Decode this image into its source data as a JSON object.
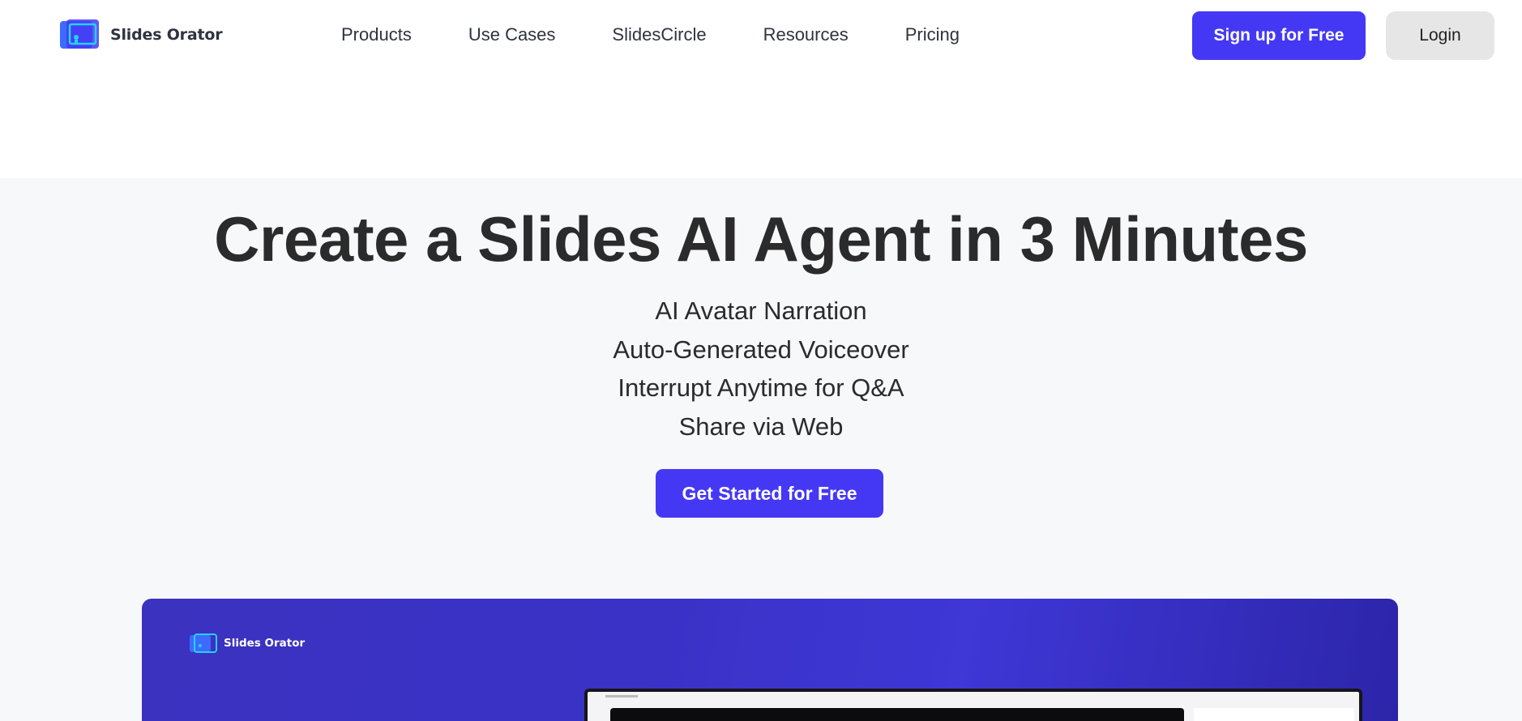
{
  "brand": {
    "name": "Slides Orator",
    "colors": {
      "primary": "#4538f5",
      "logo_blue": "#3d6bff",
      "logo_cyan": "#22d3ee",
      "hero_bg": "#f7f8fa",
      "preview_bg": "#3b32c6"
    }
  },
  "nav": {
    "items": [
      {
        "label": "Products"
      },
      {
        "label": "Use Cases"
      },
      {
        "label": "SlidesCircle"
      },
      {
        "label": "Resources"
      },
      {
        "label": "Pricing"
      }
    ]
  },
  "header": {
    "signup_label": "Sign up for Free",
    "login_label": "Login"
  },
  "hero": {
    "title": "Create a Slides AI Agent in 3 Minutes",
    "features": [
      "AI Avatar Narration",
      "Auto-Generated Voiceover",
      "Interrupt Anytime for Q&A",
      "Share via Web"
    ],
    "cta_label": "Get Started for Free"
  },
  "preview": {
    "logo_text": "Slides Orator"
  }
}
